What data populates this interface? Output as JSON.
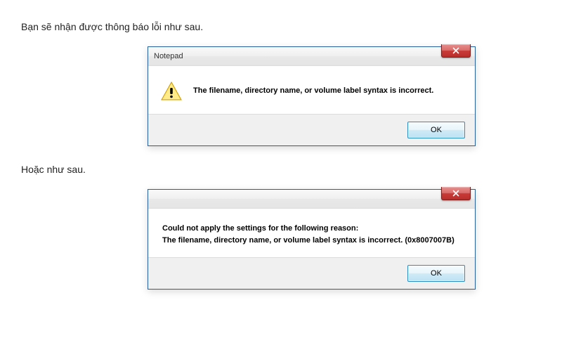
{
  "intro_text": "Bạn sẽ nhận được thông báo lỗi như sau.",
  "separator_text": "Hoặc như sau.",
  "dialog1": {
    "title": "Notepad",
    "message": "The filename, directory name, or volume label syntax is incorrect.",
    "ok_label": "OK",
    "icon": "warning-triangle"
  },
  "dialog2": {
    "title": "",
    "line1": "Could not apply the settings for the following reason:",
    "line2": "The filename, directory name, or volume label syntax is incorrect. (0x8007007B)",
    "ok_label": "OK"
  }
}
